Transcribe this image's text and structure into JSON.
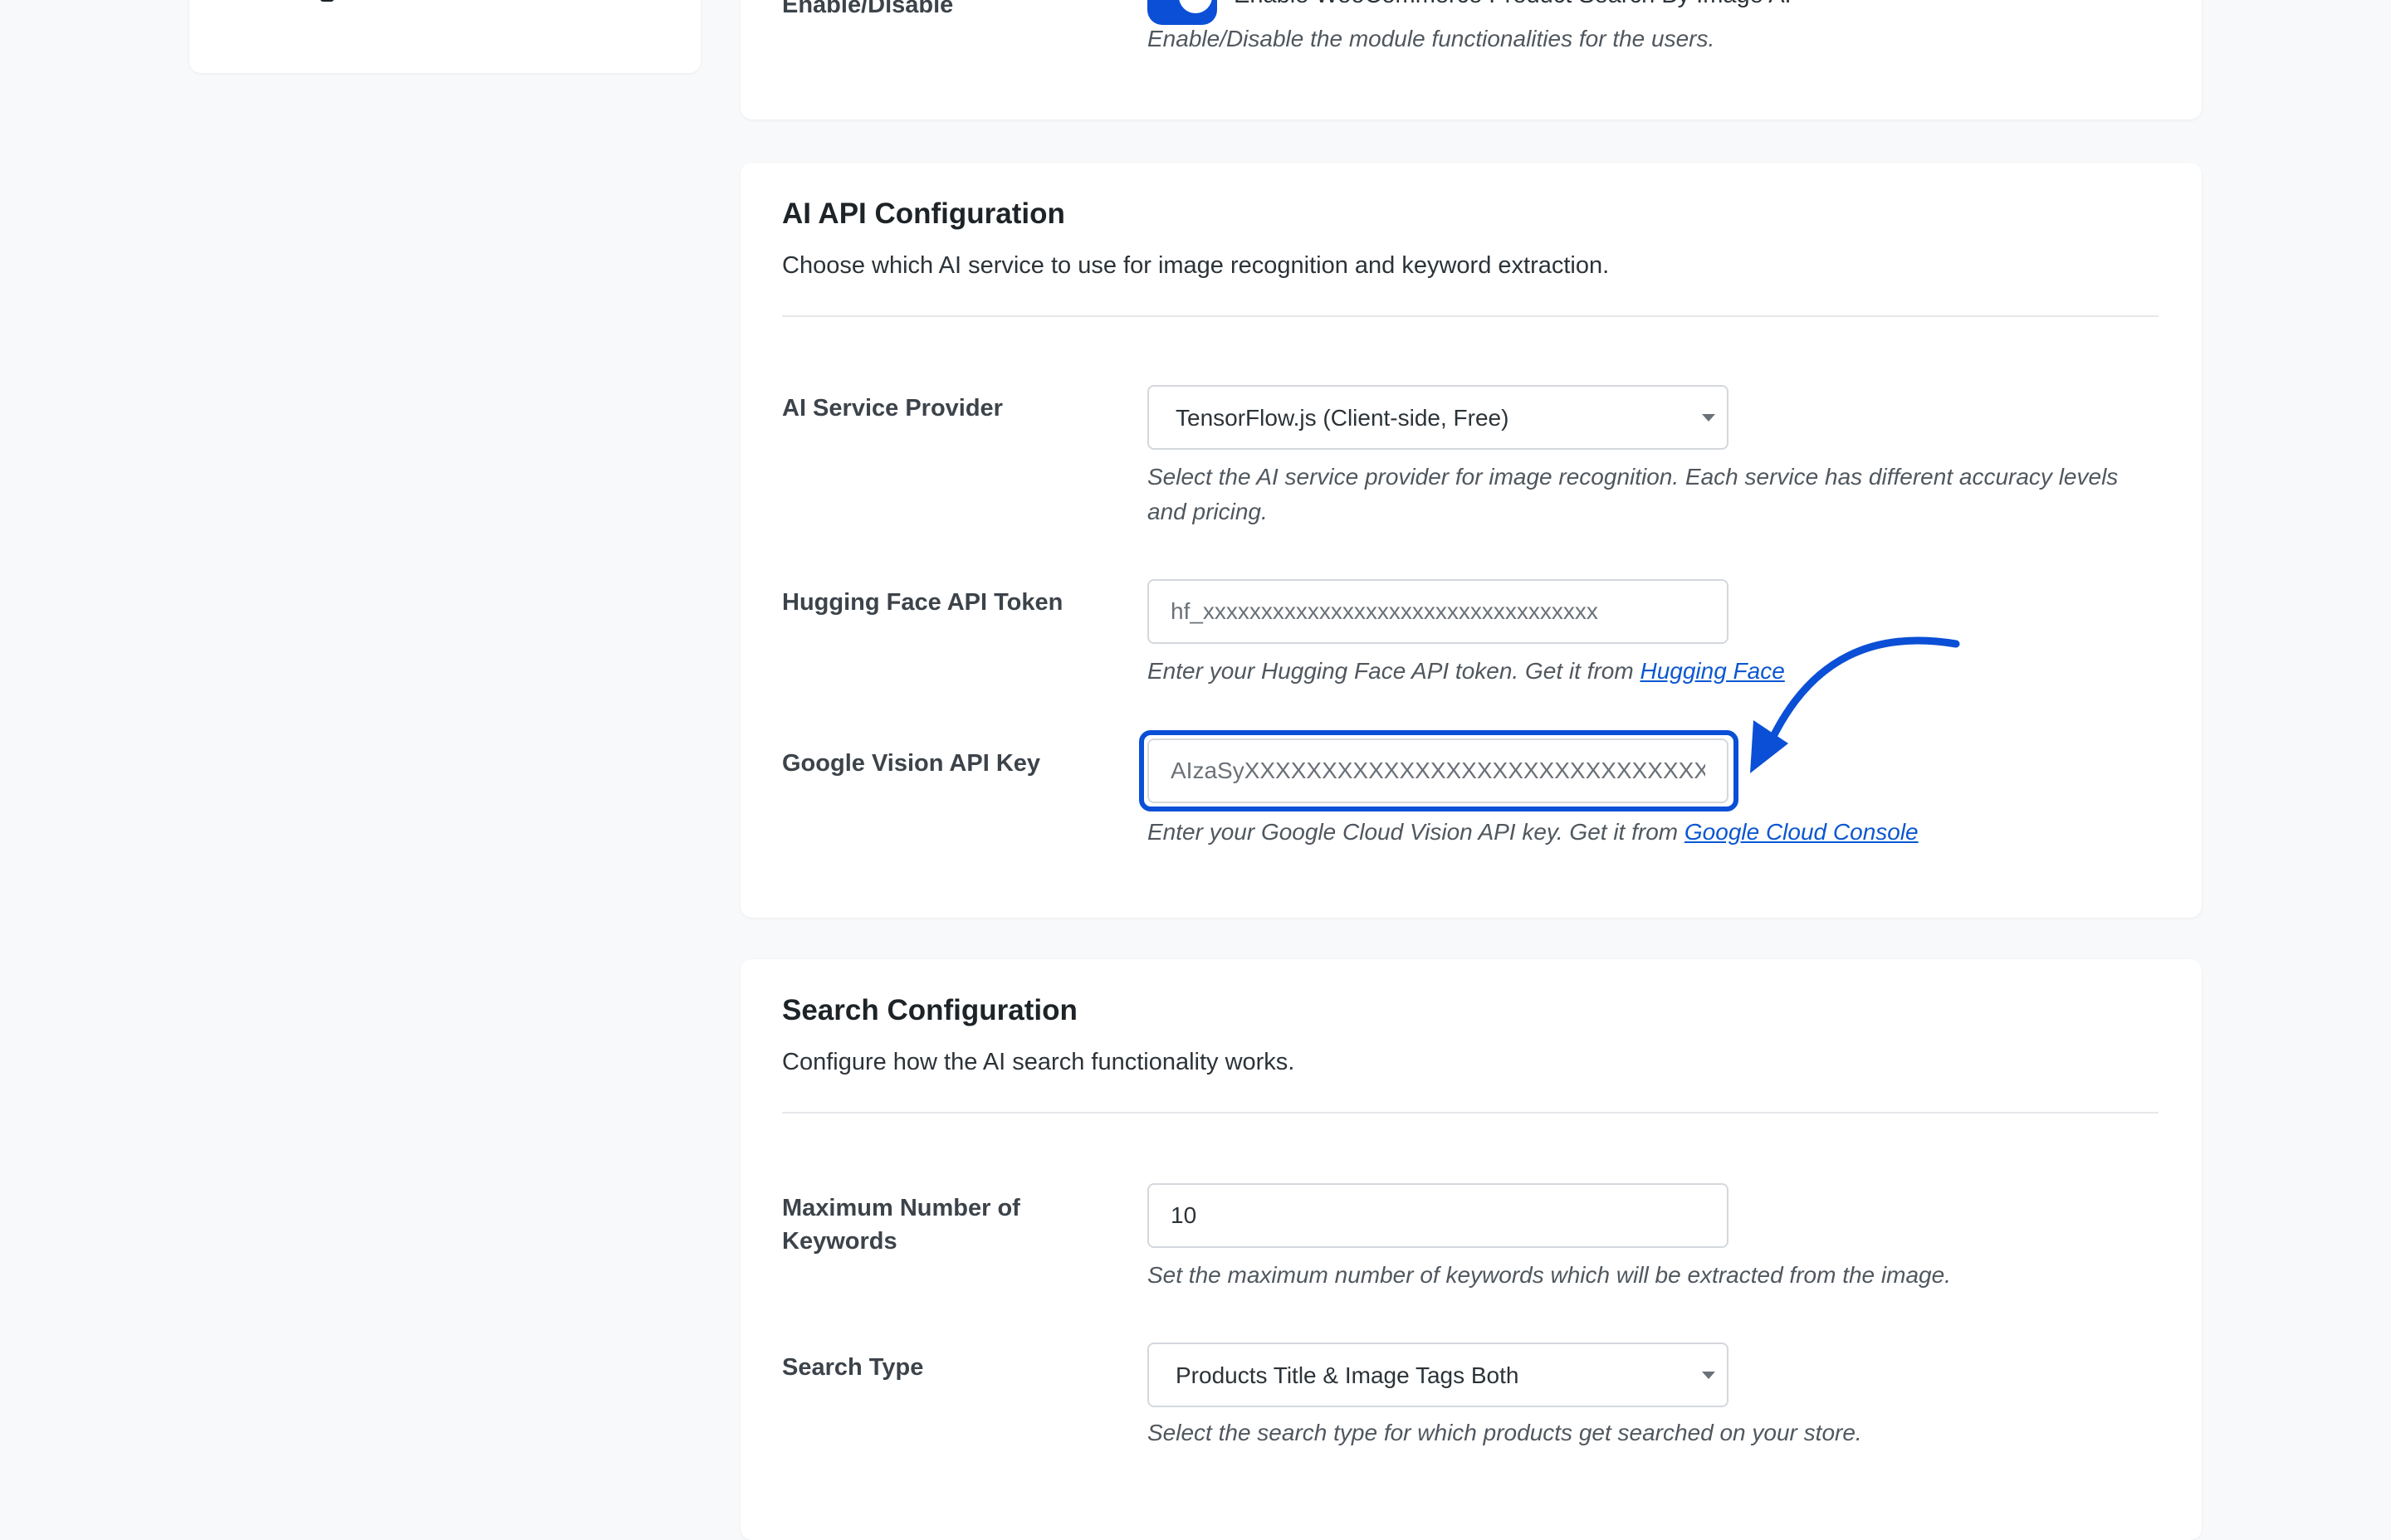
{
  "general": {
    "enable_label": "Enable/Disable",
    "toggle_label": "Enable WooCommerce Product Search By Image AI",
    "toggle_help": "Enable/Disable the module functionalities for the users."
  },
  "ai_config": {
    "title": "AI API Configuration",
    "description": "Choose which AI service to use for image recognition and keyword extraction.",
    "provider": {
      "label": "AI Service Provider",
      "selected": "TensorFlow.js (Client-side, Free)",
      "help": "Select the AI service provider for image recognition. Each service has different accuracy levels and pricing."
    },
    "hf_token": {
      "label": "Hugging Face API Token",
      "placeholder": "hf_xxxxxxxxxxxxxxxxxxxxxxxxxxxxxxxxxx",
      "help_prefix": "Enter your Hugging Face API token. Get it from ",
      "link": "Hugging Face"
    },
    "google_key": {
      "label": "Google Vision API Key",
      "placeholder": "AIzaSyXXXXXXXXXXXXXXXXXXXXXXXXXXXXXXX",
      "help_prefix": "Enter your Google Cloud Vision API key. Get it from ",
      "link": "Google Cloud Console"
    }
  },
  "search_config": {
    "title": "Search Configuration",
    "description": "Configure how the AI search functionality works.",
    "max_keywords": {
      "label": "Maximum Number of Keywords",
      "value": "10",
      "help": "Set the maximum number of keywords which will be extracted from the image."
    },
    "search_type": {
      "label": "Search Type",
      "selected": "Products Title & Image Tags Both",
      "help": "Select the search type for which products get searched on your store."
    }
  },
  "colors": {
    "accent": "#0a4fd6",
    "link": "#0b57d0",
    "background": "#f8f9fb"
  },
  "icons": {
    "select_arrow": "chevron-down-icon",
    "annotation": "curved-arrow-icon"
  }
}
